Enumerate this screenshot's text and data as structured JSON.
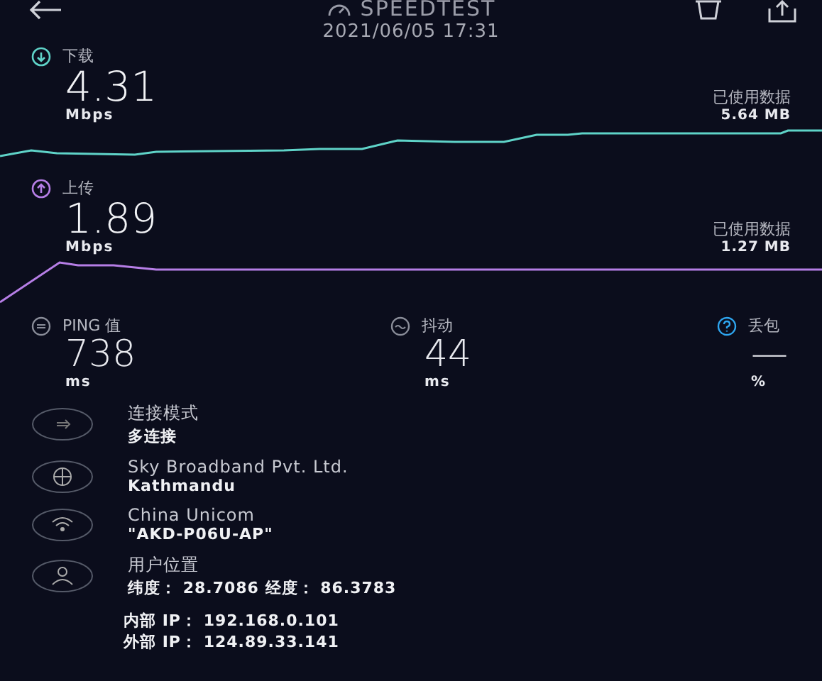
{
  "header": {
    "title": "SPEEDTEST",
    "date": "2021/06/05 17:31"
  },
  "speeds": [
    {
      "kind": "download",
      "label": "下载",
      "value": "4.31",
      "unit": "Mbps",
      "used_label": "已使用数据",
      "used": "5.64 MB",
      "color": "#5fd3c8"
    },
    {
      "kind": "upload",
      "label": "上传",
      "value": "1.89",
      "unit": "Mbps",
      "used_label": "已使用数据",
      "used": "1.27 MB",
      "color": "#b67ee6"
    }
  ],
  "stats": [
    {
      "kind": "ping",
      "label": "PING 值",
      "value": "738",
      "unit": "ms",
      "color": "#8a8d99"
    },
    {
      "kind": "jitter",
      "label": "抖动",
      "value": "44",
      "unit": "ms",
      "color": "#8a8d99"
    },
    {
      "kind": "loss",
      "label": "丢包",
      "value": "—",
      "unit": "%",
      "color": "#2ea6f0"
    }
  ],
  "info": [
    {
      "kind": "mode",
      "title": "连接模式",
      "detail": "多连接"
    },
    {
      "kind": "isp",
      "title": "Sky Broadband Pvt. Ltd.",
      "detail": "Kathmandu"
    },
    {
      "kind": "wifi",
      "title": "China Unicom",
      "detail": "\"AKD-P06U-AP\""
    },
    {
      "kind": "location",
      "title": "用户位置",
      "detail": "纬度： 28.7086 经度： 86.3783"
    }
  ],
  "ip": [
    "内部 IP： 192.168.0.101",
    "外部 IP： 124.89.33.141"
  ]
}
